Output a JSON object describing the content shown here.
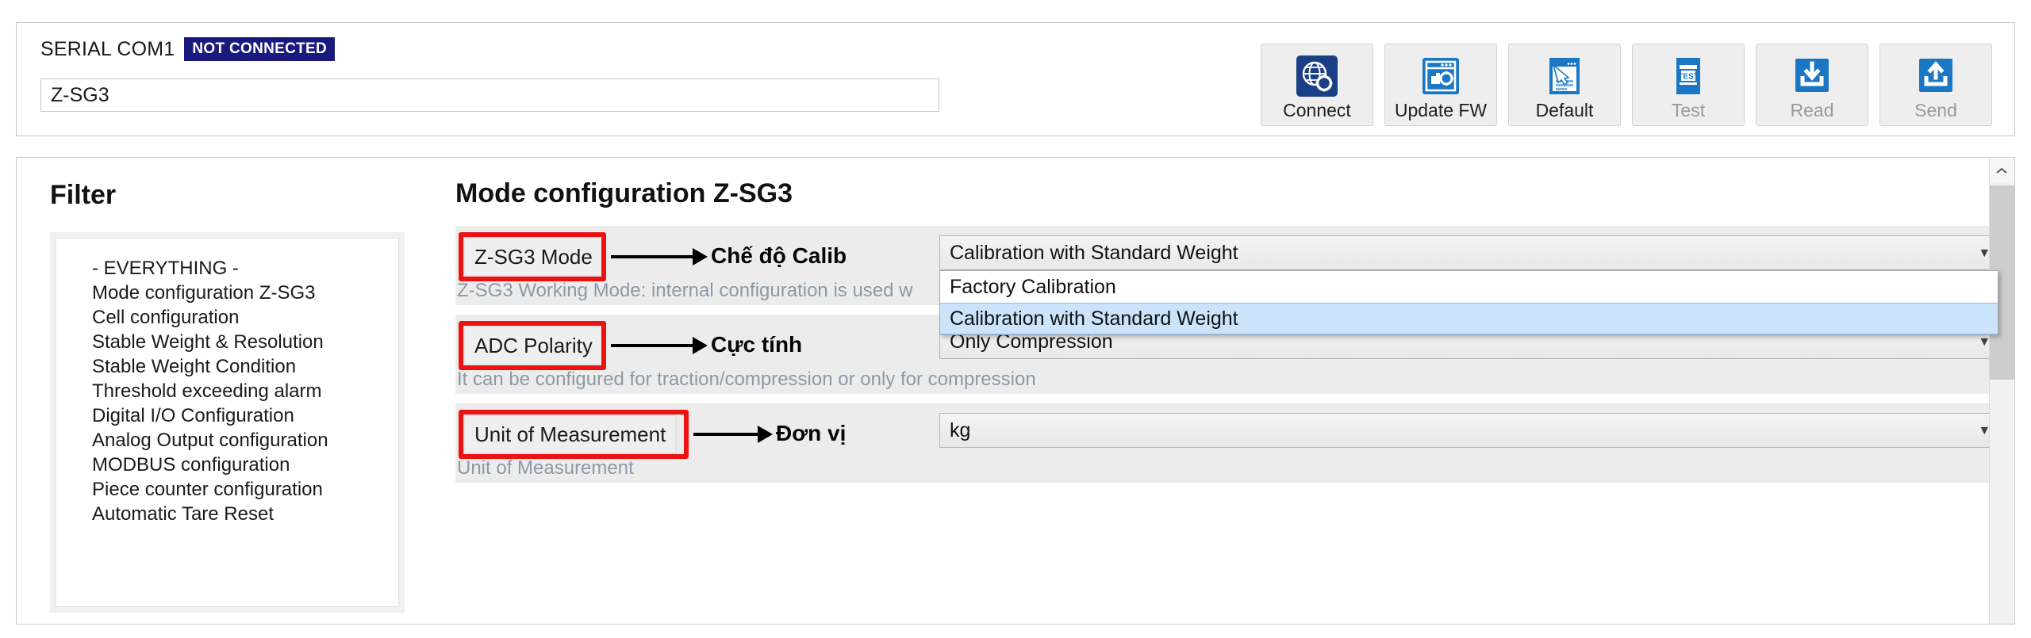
{
  "topbar": {
    "serial_label": "SERIAL COM1",
    "status_badge": "NOT CONNECTED",
    "status_badge_color": "#1a1a7e",
    "device_value": "Z-SG3",
    "buttons": [
      {
        "label": "Connect",
        "icon": "globe-gear-icon",
        "enabled": true
      },
      {
        "label": "Update FW",
        "icon": "window-gear-icon",
        "enabled": true
      },
      {
        "label": "Default",
        "icon": "window-restore-icon",
        "enabled": true
      },
      {
        "label": "Test",
        "icon": "test-screen-icon",
        "enabled": false
      },
      {
        "label": "Read",
        "icon": "download-tray-icon",
        "enabled": false
      },
      {
        "label": "Send",
        "icon": "upload-tray-icon",
        "enabled": false
      }
    ]
  },
  "sidebar": {
    "title": "Filter",
    "items": [
      {
        "label": "- EVERYTHING -"
      },
      {
        "label": "Mode configuration Z-SG3"
      },
      {
        "label": "Cell configuration"
      },
      {
        "label": "Stable Weight & Resolution"
      },
      {
        "label": "Stable Weight Condition"
      },
      {
        "label": "Threshold exceeding alarm"
      },
      {
        "label": "Digital I/O Configuration"
      },
      {
        "label": "Analog Output configuration"
      },
      {
        "label": "MODBUS configuration"
      },
      {
        "label": "Piece counter configuration"
      },
      {
        "label": "Automatic Tare Reset"
      }
    ]
  },
  "main": {
    "title": "Mode configuration Z-SG3",
    "annotation_color": "#ee1111",
    "rows": [
      {
        "label": "Z-SG3 Mode",
        "annotation_vi": "Chế độ Calib",
        "value": "Calibration with Standard Weight",
        "help": "Z-SG3 Working Mode: internal configuration is used w",
        "dropdown_open": true,
        "options": [
          {
            "label": "Factory Calibration",
            "selected": false
          },
          {
            "label": "Calibration with Standard Weight",
            "selected": true
          }
        ]
      },
      {
        "label": "ADC Polarity",
        "annotation_vi": "Cực tính",
        "value": "Only Compression",
        "help": "It can be configured for traction/compression or only for compression",
        "dropdown_open": false,
        "options": []
      },
      {
        "label": "Unit of Measurement",
        "annotation_vi": "Đơn vị",
        "value": "kg",
        "help": "Unit of Measurement",
        "dropdown_open": false,
        "options": []
      }
    ]
  },
  "scrollbar": {
    "up_arrow": "chevron-up-icon"
  }
}
